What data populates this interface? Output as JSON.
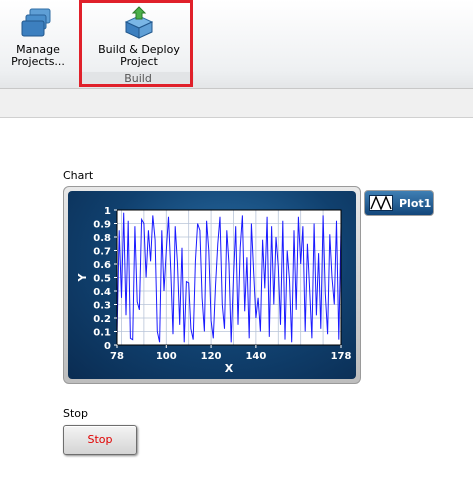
{
  "ribbon": {
    "manage_projects": {
      "line1": "Manage",
      "line2": "Projects...",
      "icon": "folders-icon"
    },
    "build_deploy": {
      "line1": "Build & Deploy",
      "line2": "Project",
      "icon": "build-deploy-icon"
    },
    "group_label": "Build"
  },
  "chart": {
    "label": "Chart",
    "legend": "Plot1"
  },
  "stop": {
    "label": "Stop",
    "button_label": "Stop"
  },
  "chart_data": {
    "type": "line",
    "title": "",
    "xlabel": "X",
    "ylabel": "Y",
    "xlim": [
      78,
      178
    ],
    "ylim": [
      0,
      1
    ],
    "x_ticks": [
      78,
      100,
      120,
      140,
      178
    ],
    "y_ticks": [
      0,
      0.1,
      0.2,
      0.3,
      0.4,
      0.5,
      0.6,
      0.7,
      0.8,
      0.9,
      1
    ],
    "grid": true,
    "legend_position": "top-right",
    "series": [
      {
        "name": "Plot1",
        "color": "#1a1aff",
        "x": [
          78,
          79,
          80,
          81,
          82,
          83,
          84,
          85,
          86,
          87,
          88,
          89,
          90,
          91,
          92,
          93,
          94,
          95,
          96,
          97,
          98,
          99,
          100,
          101,
          102,
          103,
          104,
          105,
          106,
          107,
          108,
          109,
          110,
          111,
          112,
          113,
          114,
          115,
          116,
          117,
          118,
          119,
          120,
          121,
          122,
          123,
          124,
          125,
          126,
          127,
          128,
          129,
          130,
          131,
          132,
          133,
          134,
          135,
          136,
          137,
          138,
          139,
          140,
          141,
          142,
          143,
          144,
          145,
          146,
          147,
          148,
          149,
          150,
          151,
          152,
          153,
          154,
          155,
          156,
          157,
          158,
          159,
          160,
          161,
          162,
          163,
          164,
          165,
          166,
          167,
          168,
          169,
          170,
          171,
          172,
          173,
          174,
          175,
          176,
          177,
          178
        ],
        "y": [
          0.06,
          0.85,
          0.35,
          0.98,
          0.22,
          0.92,
          0.05,
          0.04,
          0.88,
          0.32,
          0.26,
          0.93,
          0.9,
          0.5,
          0.85,
          0.62,
          0.96,
          0.78,
          0.1,
          0.02,
          0.85,
          0.4,
          0.7,
          0.95,
          0.55,
          0.08,
          0.88,
          0.6,
          0.15,
          0.72,
          0.02,
          0.47,
          0.46,
          0.12,
          0.04,
          0.62,
          0.9,
          0.85,
          0.35,
          0.1,
          0.92,
          0.7,
          0.18,
          0.05,
          0.45,
          0.75,
          0.95,
          0.3,
          0.12,
          0.85,
          0.6,
          0.02,
          0.5,
          0.88,
          0.15,
          0.72,
          0.96,
          0.25,
          0.65,
          0.05,
          0.9,
          0.55,
          0.2,
          0.35,
          0.1,
          0.78,
          0.42,
          0.95,
          0.06,
          0.88,
          0.3,
          0.8,
          0.58,
          0.15,
          0.92,
          0.04,
          0.7,
          0.48,
          0.02,
          0.85,
          0.26,
          0.95,
          0.6,
          0.88,
          0.1,
          0.75,
          0.42,
          0.05,
          0.9,
          0.22,
          0.68,
          0.12,
          0.96,
          0.38,
          0.08,
          0.82,
          0.5,
          0.3,
          0.92,
          0.04,
          0.88
        ]
      }
    ]
  }
}
